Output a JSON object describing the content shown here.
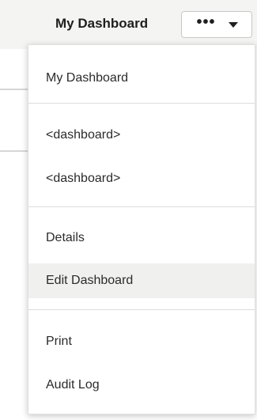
{
  "header": {
    "dashboard_title": "My Dashboard",
    "actions_label": "•••"
  },
  "menu": {
    "items": [
      {
        "label": "My Dashboard"
      },
      {
        "label": "<dashboard>"
      },
      {
        "label": "<dashboard>"
      },
      {
        "label": "Details"
      },
      {
        "label": "Edit Dashboard",
        "highlighted": true
      },
      {
        "label": "Print"
      },
      {
        "label": "Audit Log"
      }
    ]
  },
  "colors": {
    "header_background": "#f4f4f2",
    "menu_background": "#ffffff",
    "hover_background": "#f0f0ef",
    "text": "#2b2b2b"
  },
  "icons": {
    "actions": "more-horizontal-icon",
    "dropdown": "caret-down-icon"
  }
}
